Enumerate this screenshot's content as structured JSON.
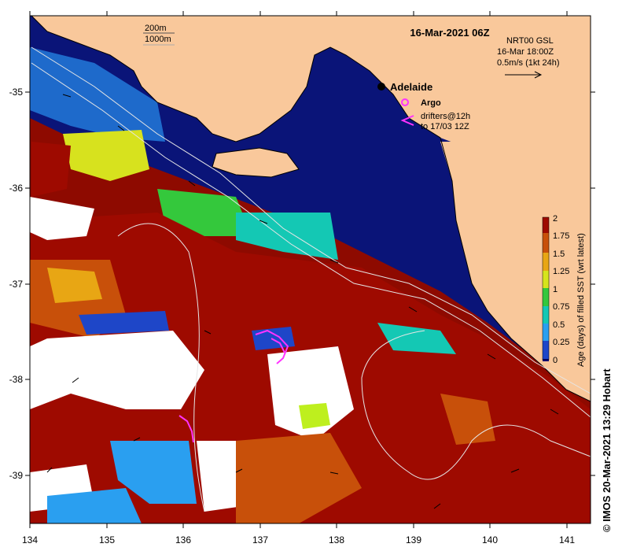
{
  "title": "16-Mar-2021 06Z",
  "map": {
    "x_ticks": [
      "134",
      "135",
      "136",
      "137",
      "138",
      "139",
      "140",
      "141"
    ],
    "y_ticks": [
      "-35",
      "-36",
      "-37",
      "-38",
      "-39"
    ],
    "lon_range": [
      134,
      141.3
    ],
    "lat_range": [
      -39.5,
      -34.2
    ],
    "land_color": "#F9C89B",
    "contour_legend": [
      "200m",
      "1000m"
    ],
    "city": "Adelaide",
    "argo_label": "Argo",
    "drifters_label_1": "drifters@12h",
    "drifters_label_2": "to 17/03 12Z"
  },
  "current_legend": {
    "line1": "NRT00 GSL",
    "line2": "16-Mar 18:00Z",
    "line3": "0.5m/s (1kt 24h)"
  },
  "colorbar": {
    "label": "Age (days) of filled SST (wrt latest)",
    "ticks": [
      "0",
      "0.25",
      "0.5",
      "0.75",
      "1",
      "1.25",
      "1.5",
      "1.75",
      "2"
    ],
    "colors": [
      "#00007A",
      "#1E46C8",
      "#2A9FF0",
      "#14C8B4",
      "#34C83C",
      "#D6E41C",
      "#E8A614",
      "#C8500A",
      "#9E0A00"
    ]
  },
  "credit": "© IMOS 20-Mar-2021 13:29 Hobart"
}
